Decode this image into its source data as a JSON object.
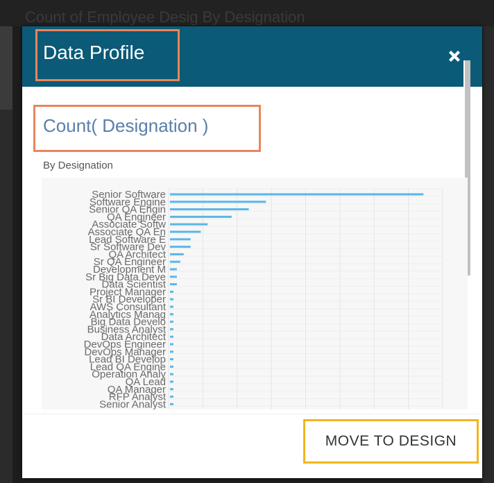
{
  "backdrop": {
    "title": "Count of Employee Desig By Designation"
  },
  "modal": {
    "title": "Data Profile",
    "close_icon": "close-x-icon",
    "chart_title": "Count( Designation )",
    "chart_subtitle": "By Designation",
    "move_button_label": "MOVE TO DESIGN"
  },
  "colors": {
    "header": "#0b5a78",
    "bar": "#5ab6e8",
    "highlight_orange": "#e8865a",
    "highlight_yellow": "#f2b51d",
    "chart_title": "#5a7fa8"
  },
  "chart_data": {
    "type": "bar",
    "orientation": "horizontal",
    "title": "Count( Designation )",
    "subtitle": "By Designation",
    "grid": true,
    "categories": [
      "Senior Software",
      "Software Engine",
      "Senior QA Engin",
      "QA Engineer",
      "Associate Softw",
      "Associate QA En",
      "Lead Software E",
      "Sr Software Dev",
      "QA Architect",
      "Sr QA Engineer",
      "Development M",
      "Sr Big Data Deve",
      "Data Scientist",
      "Project Manager",
      "Sr BI Developer",
      "AWS Consultant",
      "Analytics Manag",
      "Big Data Develo",
      "Business Analyst",
      "Data Architect",
      "DevOps Engineer",
      "DevOps Manager",
      "Lead BI Develop",
      "Lead QA Engine",
      "Operation Analy",
      "QA Lead",
      "QA Manager",
      "RFP Analyst",
      "Senior Analyst"
    ],
    "values": [
      74,
      28,
      23,
      18,
      11,
      9,
      6,
      6,
      4,
      3,
      2,
      2,
      2,
      1,
      1,
      1,
      1,
      1,
      1,
      1,
      1,
      1,
      1,
      1,
      1,
      1,
      1,
      1,
      1
    ],
    "xlim": [
      0,
      80
    ]
  }
}
